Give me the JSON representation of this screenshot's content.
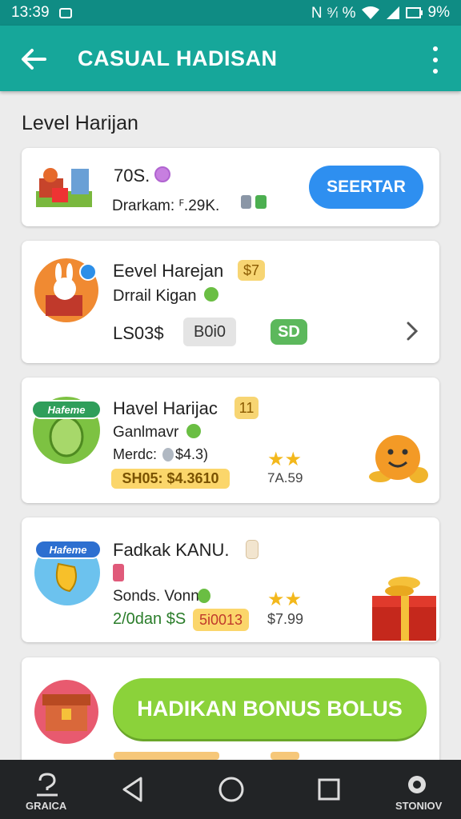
{
  "status_bar": {
    "time": "13:39",
    "indicators": "N ⁹⁄ₗ %",
    "battery": "9%"
  },
  "app_bar": {
    "title": "CASUAL HADISAN"
  },
  "section_title": "Level Harijan",
  "cards": [
    {
      "title": "70S.",
      "subtitle": "Drarkam: ꟳ.29K.",
      "button_label": "SEERTAR"
    },
    {
      "title": "Eevel Harejan",
      "badge": "$7",
      "subtitle": "Drrail Kigan",
      "price": "LS03$",
      "pill": "B0i0",
      "green_pill": "SD"
    },
    {
      "avatar_label": "Hafeme",
      "title": "Havel Harijac",
      "badge": "11",
      "subtitle": "Ganlmavr",
      "line3": "Merdc:",
      "line3_value": "$4.3)",
      "highlight": "SH05: $4.3610",
      "side_value": "7A.59"
    },
    {
      "avatar_label": "Hafeme",
      "title": "Fadkak  KANU.",
      "subtitle": "Sonds. Vonn",
      "amount": "2/0dan $S",
      "highlight": "5i0013",
      "side_value": "$7.99"
    },
    {
      "button_label": "HADIKAN BONUS BOLUS"
    }
  ],
  "nav": {
    "left_label": "GRAICA",
    "right_label": "STONIOV"
  },
  "colors": {
    "appbar": "#16a79a",
    "statusbar": "#0f8c84",
    "blue_button": "#2e8ff0",
    "green_button": "#8bd23a",
    "badge_yellow": "#f7d573",
    "green_pill": "#5cb85c"
  }
}
